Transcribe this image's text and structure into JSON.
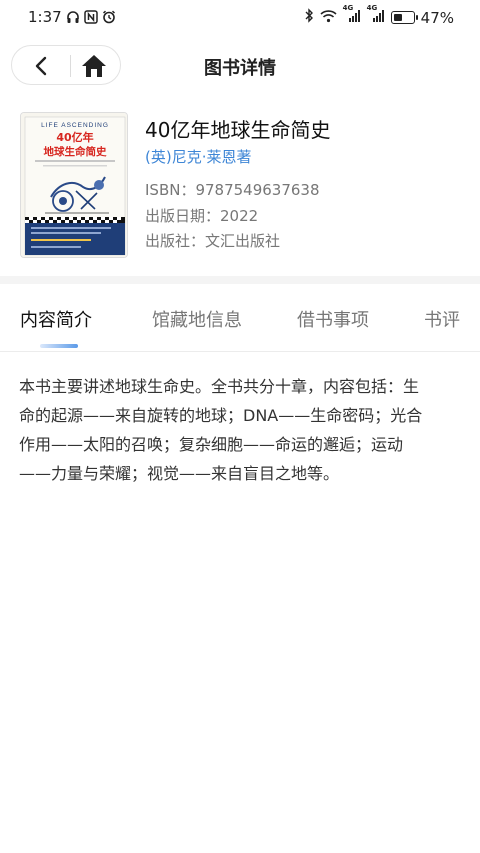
{
  "status_bar": {
    "time": "1:37",
    "battery": "47%",
    "battery_level": 0.47,
    "left_icons": [
      "headphone-icon",
      "nfc-icon",
      "alarm-icon"
    ],
    "right_icons": [
      "bluetooth-icon",
      "wifi-icon",
      "signal-icon",
      "signal-icon",
      "battery-icon"
    ],
    "network_badges": [
      "4G",
      "4G"
    ]
  },
  "header": {
    "title": "图书详情",
    "back_icon": "chevron-left-icon",
    "home_icon": "home-icon"
  },
  "book": {
    "title": "40亿年地球生命简史",
    "author": "(英)尼克·莱恩著",
    "isbn": "ISBN：9787549637638",
    "publish_date": "出版日期：2022",
    "publisher": "出版社：文汇出版社",
    "cover": {
      "top_text": "LIFE ASCENDING",
      "title_line1": "40亿年",
      "title_line2": "地球生命简史",
      "accent": "#1f3e78",
      "title_color": "#d7261f"
    }
  },
  "tabs": [
    {
      "label": "内容简介",
      "active": true
    },
    {
      "label": "馆藏地信息",
      "active": false
    },
    {
      "label": "借书事项",
      "active": false
    },
    {
      "label": "书评",
      "active": false
    }
  ],
  "intro": {
    "lines": [
      "本书主要讲述地球生命史。全书共分十章，内容包括：生",
      "命的起源——来自旋转的地球；DNA——生命密码；光合",
      "作用——太阳的召唤；复杂细胞——命运的邂逅；运动",
      "——力量与荣耀；视觉——来自盲目之地等。"
    ]
  },
  "colors": {
    "accent": "#3e86d6",
    "tab_indicator": "#5b9ae8"
  }
}
